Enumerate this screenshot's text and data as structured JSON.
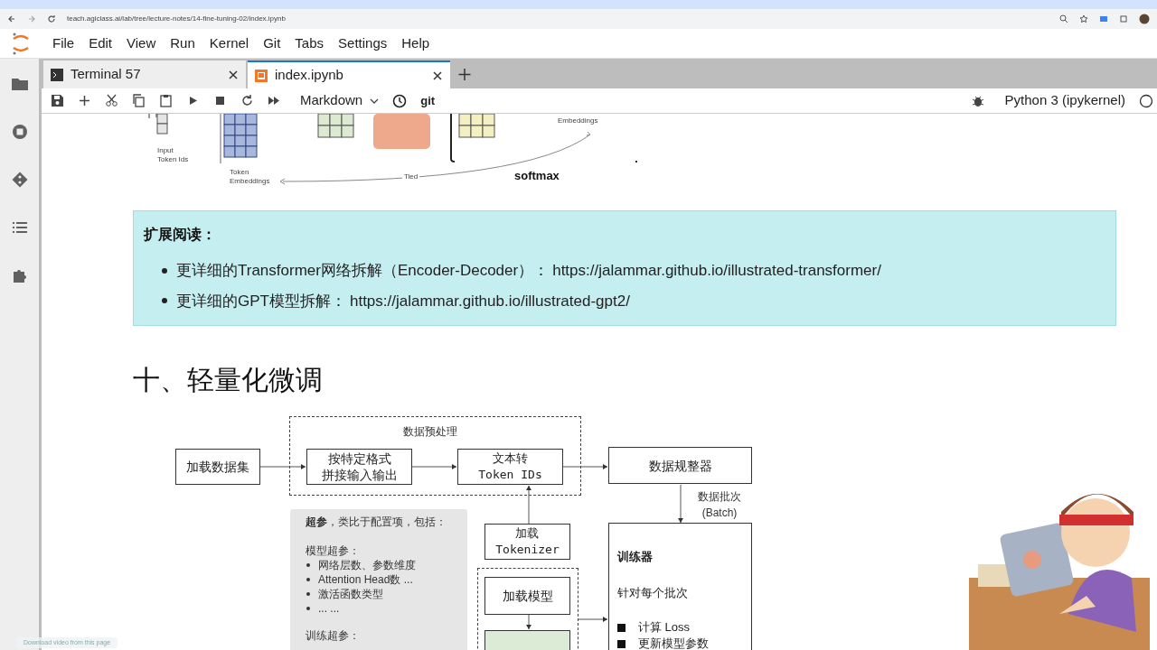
{
  "browser": {
    "address": "teach.agiclass.ai/lab/tree/lecture-notes/14-fine-tuning-02/index.ipynb"
  },
  "menu": [
    "File",
    "Edit",
    "View",
    "Run",
    "Kernel",
    "Git",
    "Tabs",
    "Settings",
    "Help"
  ],
  "tabs": [
    {
      "label": "Terminal 57",
      "kind": "terminal",
      "selected": false
    },
    {
      "label": "index.ipynb",
      "kind": "notebook",
      "selected": true
    }
  ],
  "toolbar": {
    "cell_type": "Markdown",
    "git": "git",
    "kernel": "Python 3 (ipykernel)"
  },
  "figure": {
    "input_label": [
      "Input",
      "Token Ids"
    ],
    "embed_label": [
      "Token",
      "Embeddings"
    ],
    "tied": "Tied",
    "out_label": "Embeddings",
    "softmax": "softmax"
  },
  "note": {
    "title": "扩展阅读：",
    "items": [
      {
        "text": "更详细的Transformer网络拆解（Encoder-Decoder）：",
        "link": "https://jalammar.github.io/illustrated-transformer/"
      },
      {
        "text": "更详细的GPT模型拆解：",
        "link": "https://jalammar.github.io/illustrated-gpt2/"
      }
    ]
  },
  "heading": "十、轻量化微调",
  "diagram": {
    "load_dataset": "加载数据集",
    "preprocess": "数据预处理",
    "format": [
      "按特定格式",
      "拼接输入输出"
    ],
    "to_ids": [
      "文本转",
      "Token IDs"
    ],
    "collator": "数据规整器",
    "batch": [
      "数据批次",
      "(Batch)"
    ],
    "tokenizer": [
      "加载",
      "Tokenizer"
    ],
    "load_model": "加载模型",
    "params": {
      "title": "**超参**，类比于配置项，包括：",
      "groups": [
        {
          "name": "模型超参：",
          "items": [
            "网络层数、参数维度",
            "Attention Head数 ...",
            "激活函数类型",
            "... ..."
          ]
        },
        {
          "name": "训练超参："
        }
      ]
    },
    "trainer": {
      "title": "训练器",
      "subtitle": "针对每个批次",
      "steps": [
        "计算 Loss",
        "更新模型参数"
      ]
    }
  },
  "download_hint": "Download video from this page"
}
